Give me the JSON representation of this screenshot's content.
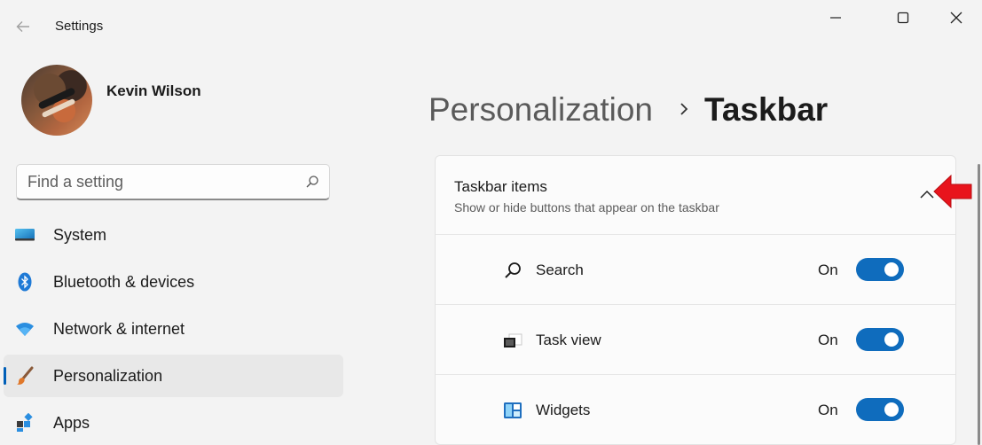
{
  "window": {
    "app_title": "Settings"
  },
  "user": {
    "name": "Kevin Wilson"
  },
  "search": {
    "placeholder": "Find a setting"
  },
  "sidebar": {
    "items": [
      {
        "label": "System",
        "icon": "system-display-icon",
        "active": false
      },
      {
        "label": "Bluetooth & devices",
        "icon": "bluetooth-icon",
        "active": false
      },
      {
        "label": "Network & internet",
        "icon": "wifi-icon",
        "active": false
      },
      {
        "label": "Personalization",
        "icon": "paintbrush-icon",
        "active": true
      },
      {
        "label": "Apps",
        "icon": "apps-icon",
        "active": false
      }
    ]
  },
  "breadcrumb": {
    "parent": "Personalization",
    "current": "Taskbar"
  },
  "section": {
    "title": "Taskbar items",
    "subtitle": "Show or hide buttons that appear on the taskbar",
    "rows": [
      {
        "label": "Search",
        "state": "On",
        "icon": "search-icon",
        "enabled": true
      },
      {
        "label": "Task view",
        "state": "On",
        "icon": "task-view-icon",
        "enabled": true
      },
      {
        "label": "Widgets",
        "state": "On",
        "icon": "widgets-icon",
        "enabled": true
      }
    ]
  },
  "colors": {
    "accent": "#0f6cbd",
    "annotation_arrow": "#e8141c"
  }
}
